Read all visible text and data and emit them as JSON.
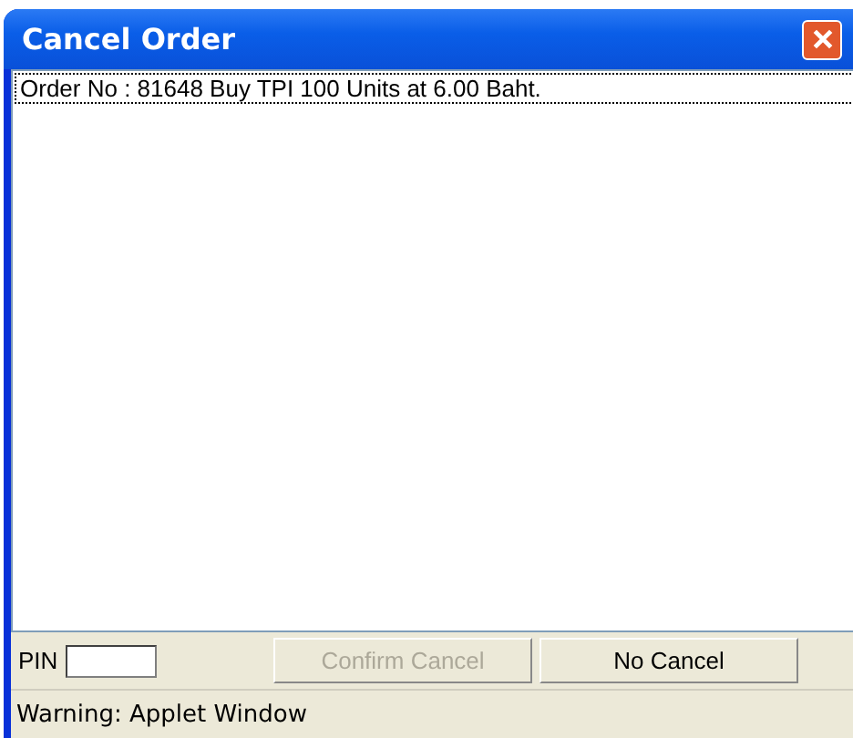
{
  "window": {
    "title": "Cancel Order"
  },
  "orders": [
    {
      "text": "Order No : 81648 Buy TPI  100 Units at  6.00 Baht.",
      "selected": true
    }
  ],
  "pin": {
    "label": "PIN"
  },
  "buttons": [
    {
      "label": "Confirm Cancel",
      "disabled": true
    },
    {
      "label": "No Cancel",
      "disabled": false
    }
  ],
  "status_bar": "Warning: Applet Window"
}
